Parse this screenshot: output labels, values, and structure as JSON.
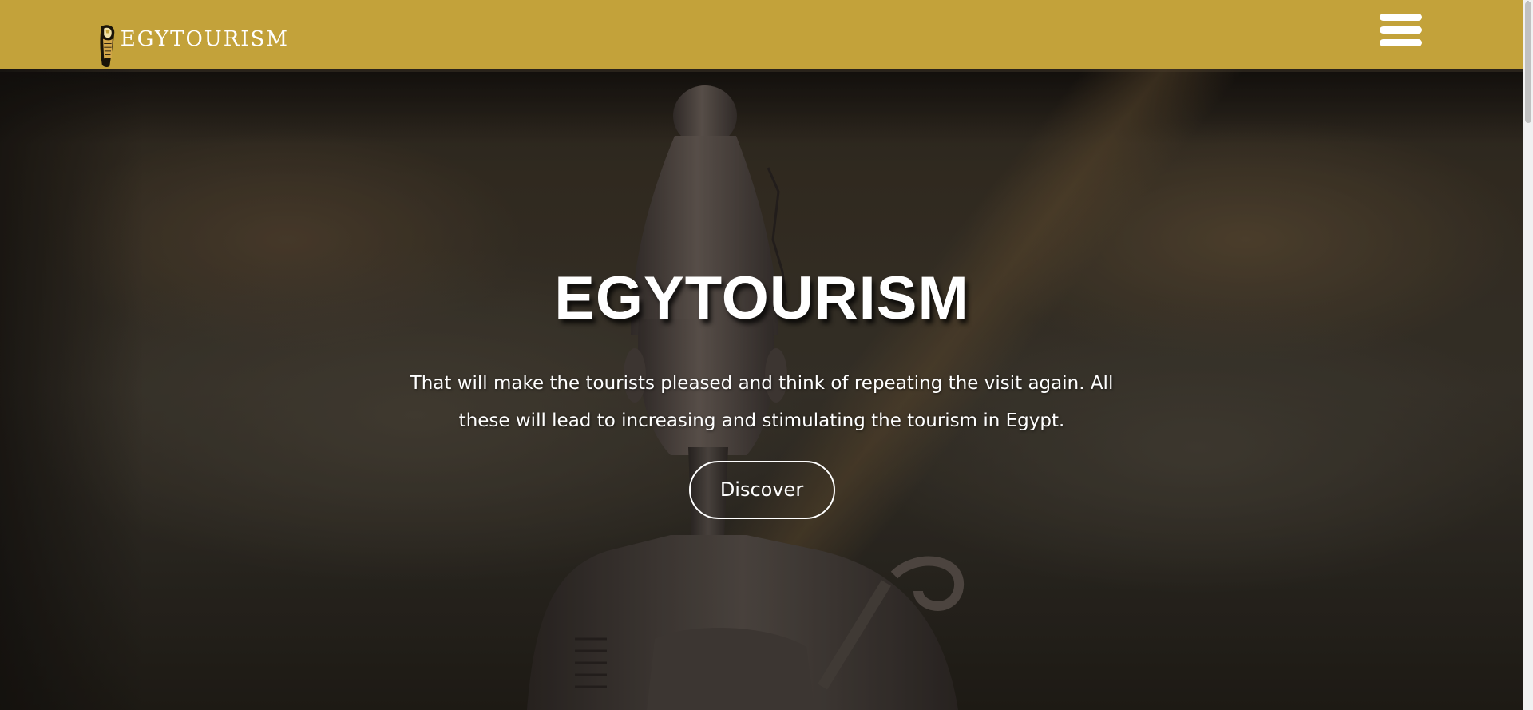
{
  "header": {
    "logo_text": "EGYTOURISM",
    "menu_icon": "hamburger-menu-icon",
    "background_color": "#c3a23a"
  },
  "hero": {
    "title": "EGYTOURISM",
    "description": "That will make the tourists pleased and think of repeating the visit again. All these will lead to increasing and stimulating the tourism in Egypt.",
    "button_label": "Discover",
    "background_image": "ancient-egyptian-statue-photo"
  }
}
